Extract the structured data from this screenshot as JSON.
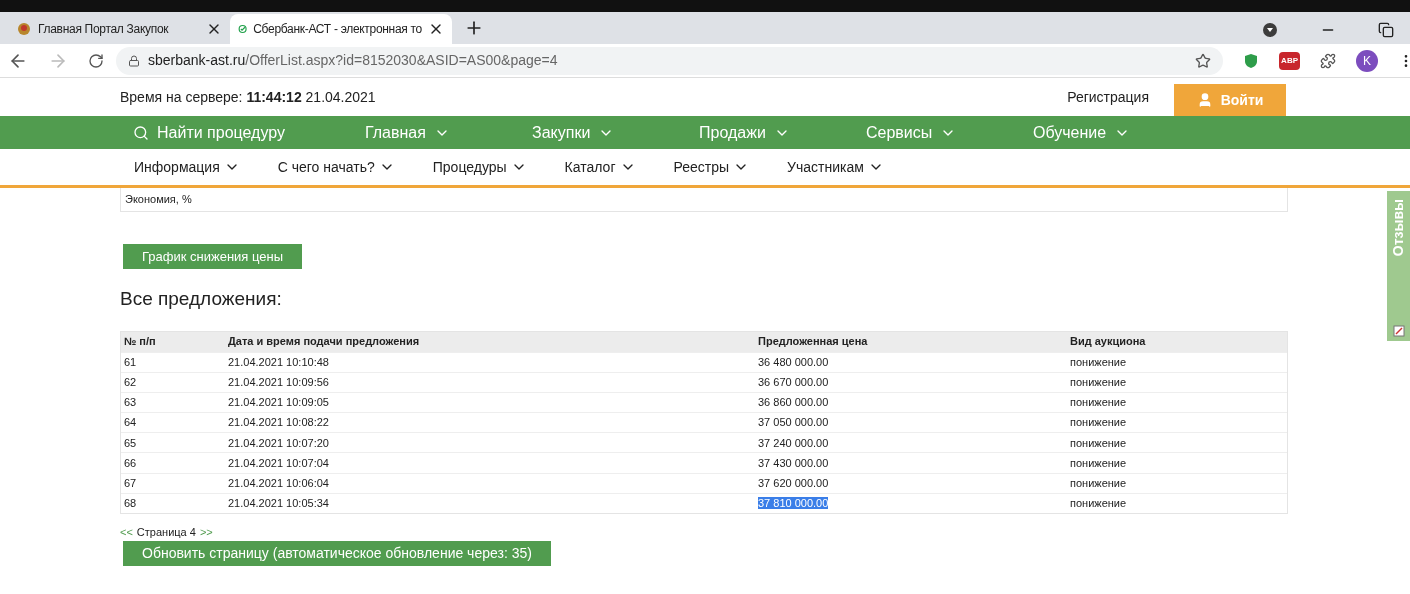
{
  "browser": {
    "tabs": [
      {
        "title": "Главная Портал Закупок",
        "selected": false
      },
      {
        "title": "Сбербанк-АСТ - электронная то",
        "selected": true
      }
    ],
    "url_host": "sberbank-ast.ru",
    "url_path": "/OfferList.aspx?id=8152030&ASID=AS00&page=4",
    "extension_label": "ABP",
    "profile_initial": "K"
  },
  "header": {
    "server_time_label": "Время на сервере:",
    "server_time": "11:44:12",
    "server_date": "21.04.2021",
    "register_link": "Регистрация",
    "login_button": "Войти"
  },
  "main_nav": {
    "search": "Найти процедуру",
    "items": [
      "Главная",
      "Закупки",
      "Продажи",
      "Сервисы",
      "Обучение"
    ]
  },
  "sub_nav": [
    "Информация",
    "С чего начать?",
    "Процедуры",
    "Каталог",
    "Реестры",
    "Участникам"
  ],
  "summary_row": "Экономия, %",
  "chart_button": "График снижения цены",
  "offers_title": "Все предложения:",
  "table": {
    "columns": [
      "№ п/п",
      "Дата и время подачи предложения",
      "Предложенная цена",
      "Вид аукциона"
    ],
    "rows": [
      {
        "num": "61",
        "datetime": "21.04.2021 10:10:48",
        "price": "36 480 000.00",
        "type": "понижение",
        "price_highlighted": false
      },
      {
        "num": "62",
        "datetime": "21.04.2021 10:09:56",
        "price": "36 670 000.00",
        "type": "понижение",
        "price_highlighted": false
      },
      {
        "num": "63",
        "datetime": "21.04.2021 10:09:05",
        "price": "36 860 000.00",
        "type": "понижение",
        "price_highlighted": false
      },
      {
        "num": "64",
        "datetime": "21.04.2021 10:08:22",
        "price": "37 050 000.00",
        "type": "понижение",
        "price_highlighted": false
      },
      {
        "num": "65",
        "datetime": "21.04.2021 10:07:20",
        "price": "37 240 000.00",
        "type": "понижение",
        "price_highlighted": false
      },
      {
        "num": "66",
        "datetime": "21.04.2021 10:07:04",
        "price": "37 430 000.00",
        "type": "понижение",
        "price_highlighted": false
      },
      {
        "num": "67",
        "datetime": "21.04.2021 10:06:04",
        "price": "37 620 000.00",
        "type": "понижение",
        "price_highlighted": false
      },
      {
        "num": "68",
        "datetime": "21.04.2021 10:05:34",
        "price": "37 810 000.00",
        "type": "понижение",
        "price_highlighted": true
      }
    ]
  },
  "pager": {
    "prev": "<<",
    "label": "Страница 4",
    "next": ">>"
  },
  "refresh_button": "Обновить страницу (автоматическое обновление через: 35)",
  "feedback_tab": "Отзывы"
}
